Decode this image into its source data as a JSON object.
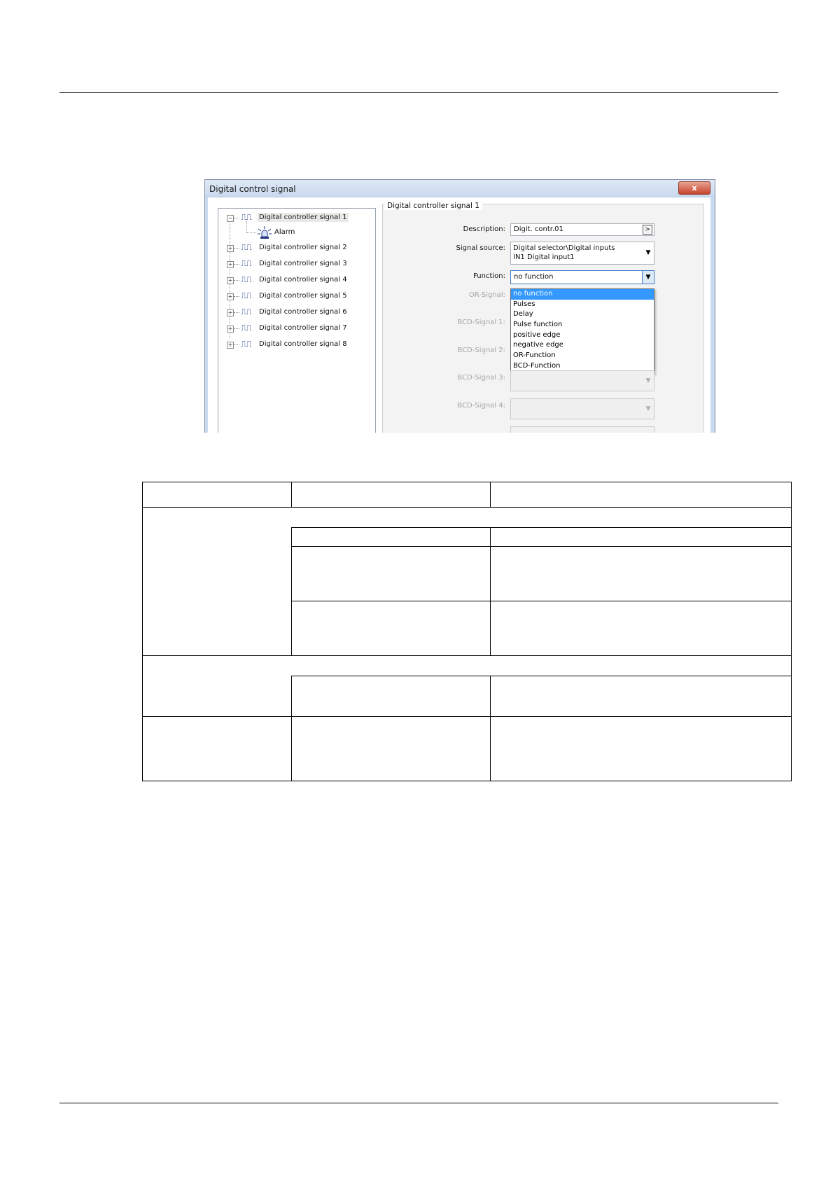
{
  "dialog": {
    "title": "Digital control signal",
    "close_label": "x",
    "tree": {
      "items": [
        {
          "label": "Digital controller signal 1",
          "expander": "−",
          "selected": true
        },
        {
          "label": "Alarm",
          "child": true
        },
        {
          "label": "Digital controller signal 2",
          "expander": "+"
        },
        {
          "label": "Digital controller signal 3",
          "expander": "+"
        },
        {
          "label": "Digital controller signal 4",
          "expander": "+"
        },
        {
          "label": "Digital controller signal 5",
          "expander": "+"
        },
        {
          "label": "Digital controller signal 6",
          "expander": "+"
        },
        {
          "label": "Digital controller signal 7",
          "expander": "+"
        },
        {
          "label": "Digital controller signal 8",
          "expander": "+"
        }
      ]
    },
    "group": {
      "title": "Digital controller signal 1",
      "description": {
        "label": "Description:",
        "value": "Digit. contr.01",
        "button": ">"
      },
      "signal_source": {
        "label": "Signal source:",
        "line1": "Digital selector\\Digital inputs",
        "line2": "IN1 Digital input1"
      },
      "function": {
        "label": "Function:",
        "value": "no function",
        "options": [
          "no function",
          "Pulses",
          "Delay",
          "Pulse function",
          "positive edge",
          "negative edge",
          "OR-Function",
          "BCD-Function"
        ]
      },
      "or_signal": {
        "label": "OR-Signal:"
      },
      "bcd_signal_1": {
        "label": "BCD-Signal 1:"
      },
      "bcd_signal_2": {
        "label": "BCD-Signal 2:"
      },
      "bcd_signal_3": {
        "label": "BCD-Signal 3:"
      },
      "bcd_signal_4": {
        "label": "BCD-Signal 4:"
      }
    }
  },
  "icons": {
    "pulse": "pulse-signal-icon",
    "alarm": "alarm-light-icon",
    "dropdown": "chevron-down-icon"
  },
  "colors": {
    "selection": "#3399ff",
    "titlebar": "#c9d9ee",
    "close": "#c7432b"
  }
}
